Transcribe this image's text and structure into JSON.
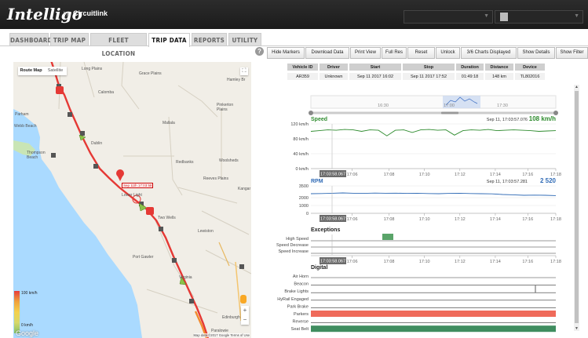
{
  "header": {
    "logo": "Intelligo",
    "by": "by",
    "brand": "Circuitlink"
  },
  "tabs": [
    "DASHBOARD",
    "TRIP MAP",
    "FLEET LOCATION",
    "TRIP DATA",
    "REPORTS",
    "UTILITY"
  ],
  "active_tab": "TRIP DATA",
  "toolbar": [
    "Hide Markers",
    "Download Data",
    "Print View",
    "Full Res",
    "Reset",
    "Unlock",
    "3/6 Charts Displayed",
    "Show Details",
    "Show Filter"
  ],
  "summary": {
    "headers": [
      "Vehicle ID",
      "Driver",
      "Start",
      "Stop",
      "Duration",
      "Distance",
      "Device"
    ],
    "row": [
      "AR359",
      "Unknown",
      "Sep 11 2017 16:02",
      "Sep 11 2017 17:52",
      "01:49:18",
      "148 km",
      "TL802016"
    ]
  },
  "map": {
    "buttons": [
      "Route Map",
      "Satellite"
    ],
    "places": [
      "Long Plains",
      "Grace Plains",
      "Hamley Br",
      "Calomba",
      "Parham",
      "Pinkerton Plains",
      "Webb Beach",
      "Mallala",
      "Dublin",
      "Thompson Beach",
      "Redbanks",
      "Woolsheds",
      "Reeves Plains",
      "Kangar",
      "Lower Light",
      "Two Wells",
      "Lewiston",
      "Port Gawler",
      "Virginia",
      "Edinburgh",
      "Paralowie"
    ],
    "marker_label": "Sep 11th 17:03:58",
    "legend_top": "100 km/h",
    "legend_bottom": "0 km/h",
    "google": "Google",
    "attribution": "Map data ©2017 Google  Terms of Use"
  },
  "chart_data": [
    {
      "type": "line",
      "title": "Speed",
      "ylabel": "",
      "yticks": [
        "0 km/h",
        "40 km/h",
        "80 km/h",
        "120 km/h"
      ],
      "ylim": [
        0,
        120
      ],
      "readout_time": "Sep 11, 17:03:57.076",
      "readout_value": "108 km/h",
      "xticks": [
        "17:06",
        "17:08",
        "17:10",
        "17:12",
        "17:14",
        "17:16",
        "17:18"
      ],
      "cursor_label": "17:03:58.067",
      "series": [
        {
          "values": [
            100,
            102,
            104,
            103,
            105,
            104,
            100,
            104,
            103,
            88,
            103,
            104,
            97,
            104,
            105,
            103,
            104,
            90,
            102,
            104,
            103,
            105,
            102,
            103,
            104,
            103,
            102,
            100,
            101,
            102
          ]
        }
      ]
    },
    {
      "type": "line",
      "title": "RPM",
      "yticks": [
        "0",
        "1000",
        "2000",
        "3500"
      ],
      "ylim": [
        0,
        3500
      ],
      "readout_time": "Sep 11, 17:03:57.281",
      "readout_value": "2 520",
      "xticks": [
        "17:06",
        "17:08",
        "17:10",
        "17:12",
        "17:14",
        "17:16",
        "17:18"
      ],
      "cursor_label": "17:03:58.067",
      "series": [
        {
          "values": [
            2500,
            2520,
            2560,
            2600,
            2560,
            2540,
            2580,
            2560,
            2570,
            2540,
            2560,
            2520,
            2500,
            2540,
            2560,
            2520,
            2500,
            2480,
            2400,
            2360,
            2300,
            2320,
            2300,
            2260
          ]
        }
      ]
    },
    {
      "type": "timeline",
      "title": "Exceptions",
      "rows": [
        "High Speed",
        "Speed Decrease",
        "Speed Increase"
      ],
      "xticks": [
        "17:06",
        "17:08",
        "17:10",
        "17:12",
        "17:14",
        "17:16",
        "17:18"
      ],
      "cursor_label": "17:03:58.067"
    },
    {
      "type": "timeline",
      "title": "Digital",
      "rows": [
        "Air Horn",
        "Beacon",
        "Brake Lights",
        "HyRail Engaged",
        "Park Brake",
        "Parkers",
        "Reverse",
        "Seat Belt"
      ]
    }
  ],
  "navigator": {
    "xticks": [
      "16:30",
      "17:00",
      "17:30"
    ]
  }
}
